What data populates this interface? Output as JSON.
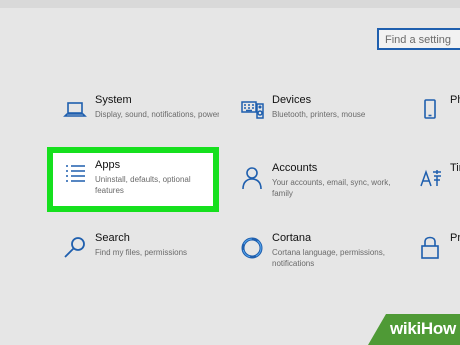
{
  "search": {
    "placeholder": "Find a setting"
  },
  "tiles": {
    "system": {
      "title": "System",
      "desc": "Display, sound, notifications, power"
    },
    "devices": {
      "title": "Devices",
      "desc": "Bluetooth, printers, mouse"
    },
    "phone": {
      "title": "Ph"
    },
    "apps": {
      "title": "Apps",
      "desc": "Uninstall, defaults, optional features"
    },
    "accounts": {
      "title": "Accounts",
      "desc": "Your accounts, email, sync, work, family"
    },
    "time": {
      "title": "Tim"
    },
    "search": {
      "title": "Search",
      "desc": "Find my files, permissions"
    },
    "cortana": {
      "title": "Cortana",
      "desc": "Cortana language, permissions, notifications"
    },
    "privacy": {
      "title": "Pri"
    }
  },
  "colors": {
    "accent": "#1f5fae",
    "highlight": "#16e01e",
    "watermark_bg": "#4f9a36"
  },
  "watermark": {
    "text": "wikiHow"
  }
}
